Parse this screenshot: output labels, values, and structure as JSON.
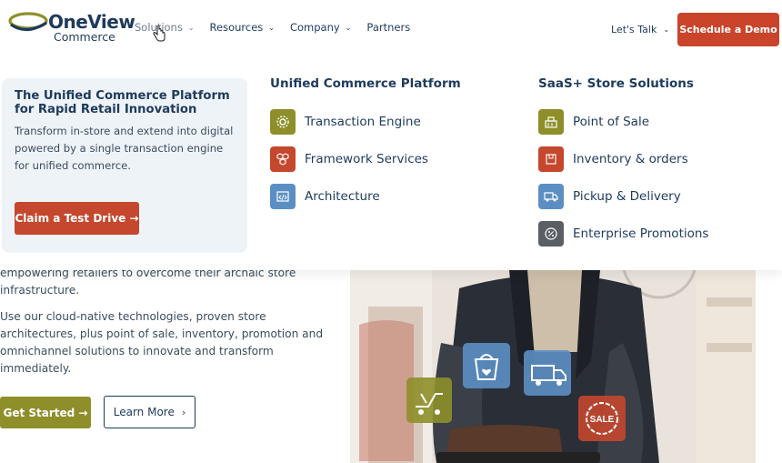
{
  "brand": {
    "name": "OneView",
    "sub": "Commerce"
  },
  "nav": {
    "items": [
      {
        "label": "Solutions"
      },
      {
        "label": "Resources"
      },
      {
        "label": "Company"
      },
      {
        "label": "Partners"
      }
    ],
    "lets_talk": "Let's Talk",
    "demo_button": "Schedule a Demo"
  },
  "mega": {
    "promo": {
      "title": "The Unified Commerce Platform for Rapid Retail Innovation",
      "description": "Transform in-store and extend into digital powered by a single transaction engine for unified commerce.",
      "button": "Claim a Test Drive →"
    },
    "col1": {
      "heading": "Unified Commerce Platform",
      "items": [
        {
          "label": "Transaction Engine",
          "icon": "gear-icon",
          "color": "#8e8f2a"
        },
        {
          "label": "Framework Services",
          "icon": "cubes-icon",
          "color": "#c4472e"
        },
        {
          "label": "Architecture",
          "icon": "code-window-icon",
          "color": "#5b8fc4"
        }
      ]
    },
    "col2": {
      "heading": "SaaS+ Store Solutions",
      "items": [
        {
          "label": "Point of Sale",
          "icon": "register-icon",
          "color": "#8e8f2a"
        },
        {
          "label": "Inventory & orders",
          "icon": "box-icon",
          "color": "#c4472e"
        },
        {
          "label": "Pickup & Delivery",
          "icon": "truck-icon",
          "color": "#5b8fc4"
        },
        {
          "label": "Enterprise Promotions",
          "icon": "percent-badge-icon",
          "color": "#5a5f66"
        }
      ]
    }
  },
  "hero": {
    "para1_line1": "empowering retailers to overcome their archaic store",
    "para1_line2": "infrastructure.",
    "para2_line1": "Use our cloud-native technologies, proven store",
    "para2_line2": "architectures, plus point of sale, inventory, promotion and",
    "para2_line3": "omnichannel solutions to innovate and transform",
    "para2_line4": "immediately.",
    "get_started": "Get Started →",
    "learn_more": "Learn More",
    "sale_badge": "SALE"
  }
}
